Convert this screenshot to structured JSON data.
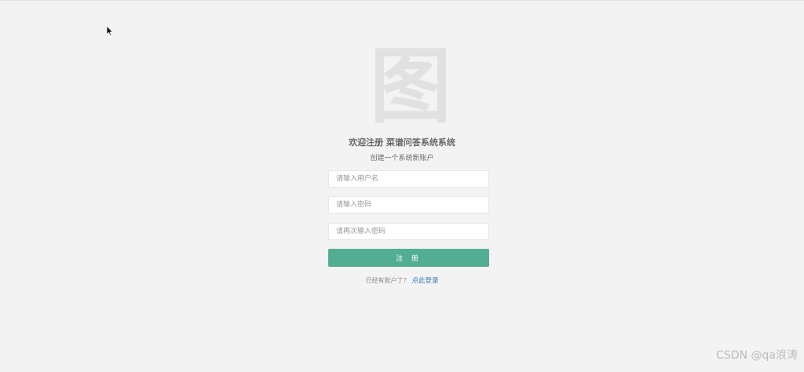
{
  "logo": {
    "glyph": "图"
  },
  "header": {
    "title": "欢迎注册 菜谱问答系统系统",
    "subtitle": "创建一个系统新账户"
  },
  "form": {
    "username_placeholder": "请输入用户名",
    "password_placeholder": "请输入密码",
    "password_confirm_placeholder": "请再次输入密码",
    "submit_label": "注 册"
  },
  "footer": {
    "prompt": "已经有账户了？",
    "login_link": "点此登录"
  },
  "watermark": "CSDN @qa浪涛",
  "colors": {
    "background": "#f3f3f4",
    "button": "#52ad93",
    "link": "#337ab7"
  },
  "icons": {
    "cursor": "mouse-pointer-icon"
  }
}
